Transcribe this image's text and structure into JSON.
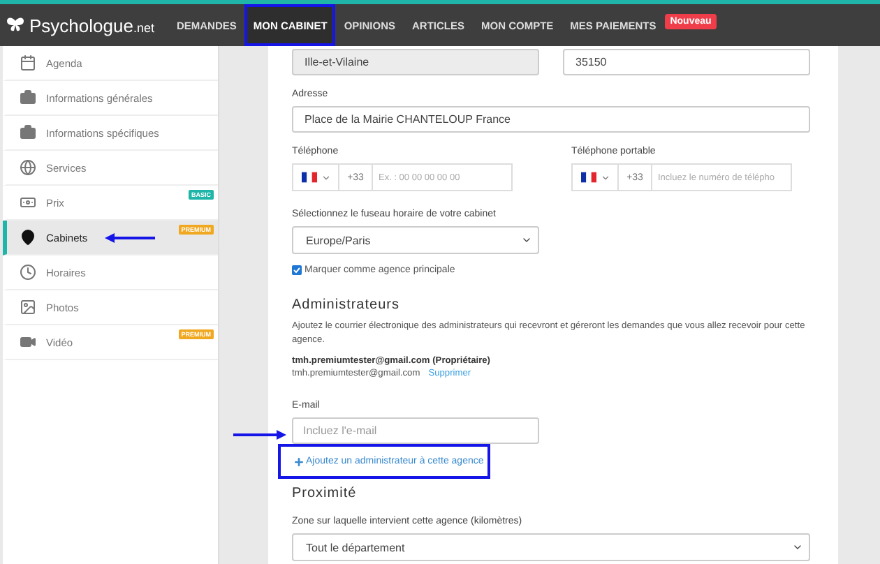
{
  "header": {
    "logo": {
      "name": "Psychologue",
      "suffix": ".net"
    },
    "nav": [
      {
        "label": "DEMANDES",
        "selected": false,
        "annotated": false
      },
      {
        "label": "MON CABINET",
        "selected": true,
        "annotated": true
      },
      {
        "label": "OPINIONS",
        "selected": false,
        "annotated": false
      },
      {
        "label": "ARTICLES",
        "selected": false,
        "annotated": false
      },
      {
        "label": "MON COMPTE",
        "selected": false,
        "annotated": false
      },
      {
        "label": "MES PAIEMENTS",
        "selected": false,
        "annotated": false
      }
    ],
    "badge": "Nouveau"
  },
  "sidebar": {
    "items": [
      {
        "label": "Agenda",
        "selected": false,
        "arrow": false
      },
      {
        "label": "Informations générales",
        "selected": false,
        "arrow": false
      },
      {
        "label": "Informations spécifiques",
        "selected": false,
        "arrow": false
      },
      {
        "label": "Services",
        "selected": false,
        "arrow": false
      },
      {
        "label": "Prix",
        "selected": false,
        "badge": {
          "text": "BASIC",
          "kind": "basic"
        },
        "arrow": false
      },
      {
        "label": "Cabinets",
        "selected": true,
        "badge": {
          "text": "PREMIUM",
          "kind": "premium"
        },
        "arrow": true
      },
      {
        "label": "Horaires",
        "selected": false,
        "arrow": false
      },
      {
        "label": "Photos",
        "selected": false,
        "arrow": false
      },
      {
        "label": "Vidéo",
        "selected": false,
        "badge": {
          "text": "PREMIUM",
          "kind": "premium"
        },
        "arrow": false
      }
    ]
  },
  "form": {
    "region": "Ille-et-Vilaine",
    "postcode": "35150",
    "address": {
      "label": "Adresse",
      "value": "Place de la Mairie  CHANTELOUP France"
    },
    "phones": [
      {
        "label": "Téléphone",
        "code": "+33",
        "placeholder": "Ex. : 00 00 00 00 00"
      },
      {
        "label": "Téléphone portable",
        "code": "+33",
        "placeholder": "Incluez le numéro de télépho"
      }
    ],
    "timezone": {
      "label": "Sélectionnez le fuseau horaire de votre cabinet",
      "value": "Europe/Paris"
    },
    "main_agency": {
      "label": "Marquer comme agence principale",
      "checked": true
    },
    "admins": {
      "title": "Administrateurs",
      "description": "Ajoutez le courrier électronique des administrateurs qui recevront et géreront les demandes que vous allez recevoir pour cette agence.",
      "owner": "tmh.premiumtester@gmail.com (Propriétaire)",
      "email": "tmh.premiumtester@gmail.com",
      "remove": "Supprimer",
      "email_label": "E-mail",
      "email_placeholder": "Incluez l'e-mail",
      "add_link": "Ajoutez un administrateur à cette agence",
      "add_annotated": true
    },
    "proximity": {
      "title": "Proximité",
      "label": "Zone sur laquelle intervient cette agence (kilomètres)",
      "value": "Tout le département"
    }
  }
}
